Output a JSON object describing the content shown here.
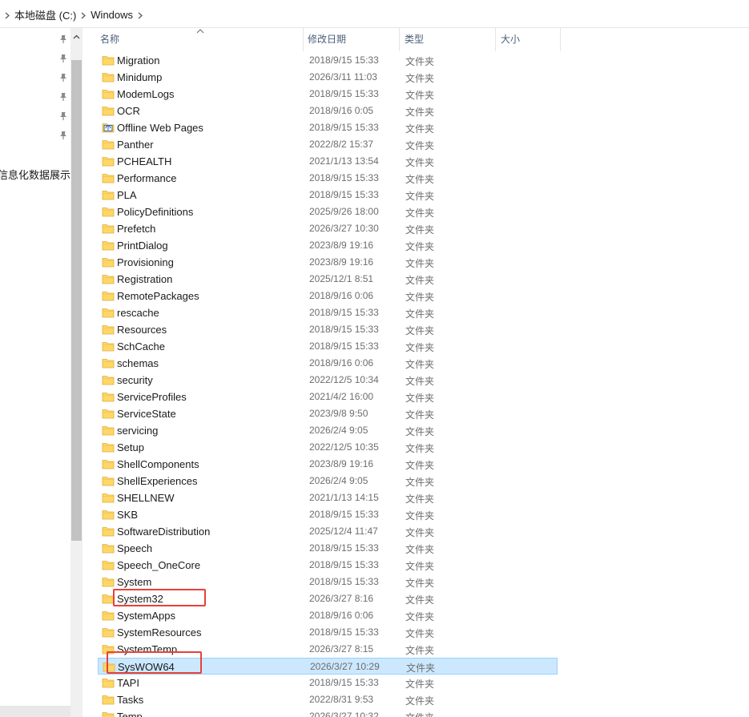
{
  "breadcrumb": {
    "items": [
      "本地磁盘 (C:)",
      "Windows"
    ]
  },
  "nav": {
    "truncated_label": "信息化数据展示系"
  },
  "columns": {
    "name": "名称",
    "date": "修改日期",
    "type": "类型",
    "size": "大小"
  },
  "files": [
    {
      "name": "Migration",
      "date": "2018/9/15 15:33",
      "type": "文件夹",
      "icon": "folder-icon"
    },
    {
      "name": "Minidump",
      "date": "2026/3/11 11:03",
      "type": "文件夹",
      "icon": "folder-icon"
    },
    {
      "name": "ModemLogs",
      "date": "2018/9/15 15:33",
      "type": "文件夹",
      "icon": "folder-icon"
    },
    {
      "name": "OCR",
      "date": "2018/9/16 0:05",
      "type": "文件夹",
      "icon": "folder-icon"
    },
    {
      "name": "Offline Web Pages",
      "date": "2018/9/15 15:33",
      "type": "文件夹",
      "icon": "offline-web-pages-icon"
    },
    {
      "name": "Panther",
      "date": "2022/8/2 15:37",
      "type": "文件夹",
      "icon": "folder-icon"
    },
    {
      "name": "PCHEALTH",
      "date": "2021/1/13 13:54",
      "type": "文件夹",
      "icon": "folder-icon"
    },
    {
      "name": "Performance",
      "date": "2018/9/15 15:33",
      "type": "文件夹",
      "icon": "folder-icon"
    },
    {
      "name": "PLA",
      "date": "2018/9/15 15:33",
      "type": "文件夹",
      "icon": "folder-icon"
    },
    {
      "name": "PolicyDefinitions",
      "date": "2025/9/26 18:00",
      "type": "文件夹",
      "icon": "folder-icon"
    },
    {
      "name": "Prefetch",
      "date": "2026/3/27 10:30",
      "type": "文件夹",
      "icon": "folder-icon"
    },
    {
      "name": "PrintDialog",
      "date": "2023/8/9 19:16",
      "type": "文件夹",
      "icon": "folder-icon"
    },
    {
      "name": "Provisioning",
      "date": "2023/8/9 19:16",
      "type": "文件夹",
      "icon": "folder-icon"
    },
    {
      "name": "Registration",
      "date": "2025/12/1 8:51",
      "type": "文件夹",
      "icon": "folder-icon"
    },
    {
      "name": "RemotePackages",
      "date": "2018/9/16 0:06",
      "type": "文件夹",
      "icon": "folder-icon"
    },
    {
      "name": "rescache",
      "date": "2018/9/15 15:33",
      "type": "文件夹",
      "icon": "folder-icon"
    },
    {
      "name": "Resources",
      "date": "2018/9/15 15:33",
      "type": "文件夹",
      "icon": "folder-icon"
    },
    {
      "name": "SchCache",
      "date": "2018/9/15 15:33",
      "type": "文件夹",
      "icon": "folder-icon"
    },
    {
      "name": "schemas",
      "date": "2018/9/16 0:06",
      "type": "文件夹",
      "icon": "folder-icon"
    },
    {
      "name": "security",
      "date": "2022/12/5 10:34",
      "type": "文件夹",
      "icon": "folder-icon"
    },
    {
      "name": "ServiceProfiles",
      "date": "2021/4/2 16:00",
      "type": "文件夹",
      "icon": "folder-icon"
    },
    {
      "name": "ServiceState",
      "date": "2023/9/8 9:50",
      "type": "文件夹",
      "icon": "folder-icon"
    },
    {
      "name": "servicing",
      "date": "2026/2/4 9:05",
      "type": "文件夹",
      "icon": "folder-icon"
    },
    {
      "name": "Setup",
      "date": "2022/12/5 10:35",
      "type": "文件夹",
      "icon": "folder-icon"
    },
    {
      "name": "ShellComponents",
      "date": "2023/8/9 19:16",
      "type": "文件夹",
      "icon": "folder-icon"
    },
    {
      "name": "ShellExperiences",
      "date": "2026/2/4 9:05",
      "type": "文件夹",
      "icon": "folder-icon"
    },
    {
      "name": "SHELLNEW",
      "date": "2021/1/13 14:15",
      "type": "文件夹",
      "icon": "folder-icon"
    },
    {
      "name": "SKB",
      "date": "2018/9/15 15:33",
      "type": "文件夹",
      "icon": "folder-icon"
    },
    {
      "name": "SoftwareDistribution",
      "date": "2025/12/4 11:47",
      "type": "文件夹",
      "icon": "folder-icon"
    },
    {
      "name": "Speech",
      "date": "2018/9/15 15:33",
      "type": "文件夹",
      "icon": "folder-icon"
    },
    {
      "name": "Speech_OneCore",
      "date": "2018/9/15 15:33",
      "type": "文件夹",
      "icon": "folder-icon"
    },
    {
      "name": "System",
      "date": "2018/9/15 15:33",
      "type": "文件夹",
      "icon": "folder-icon"
    },
    {
      "name": "System32",
      "date": "2026/3/27 8:16",
      "type": "文件夹",
      "icon": "folder-icon",
      "highlighted": true
    },
    {
      "name": "SystemApps",
      "date": "2018/9/16 0:06",
      "type": "文件夹",
      "icon": "folder-icon"
    },
    {
      "name": "SystemResources",
      "date": "2018/9/15 15:33",
      "type": "文件夹",
      "icon": "folder-icon"
    },
    {
      "name": "SystemTemp",
      "date": "2026/3/27 8:15",
      "type": "文件夹",
      "icon": "folder-icon"
    },
    {
      "name": "SysWOW64",
      "date": "2026/3/27 10:29",
      "type": "文件夹",
      "icon": "folder-icon",
      "selected": true,
      "highlighted": true
    },
    {
      "name": "TAPI",
      "date": "2018/9/15 15:33",
      "type": "文件夹",
      "icon": "folder-icon"
    },
    {
      "name": "Tasks",
      "date": "2022/8/31 9:53",
      "type": "文件夹",
      "icon": "folder-icon"
    },
    {
      "name": "Temp",
      "date": "2026/3/27 10:32",
      "type": "文件夹",
      "icon": "folder-icon"
    }
  ],
  "colors": {
    "selection_bg": "#cce8ff",
    "selection_border": "#99d1ff",
    "highlight_box": "#e8413a",
    "folder_fill": "#ffd766",
    "header_text": "#4c607a"
  }
}
